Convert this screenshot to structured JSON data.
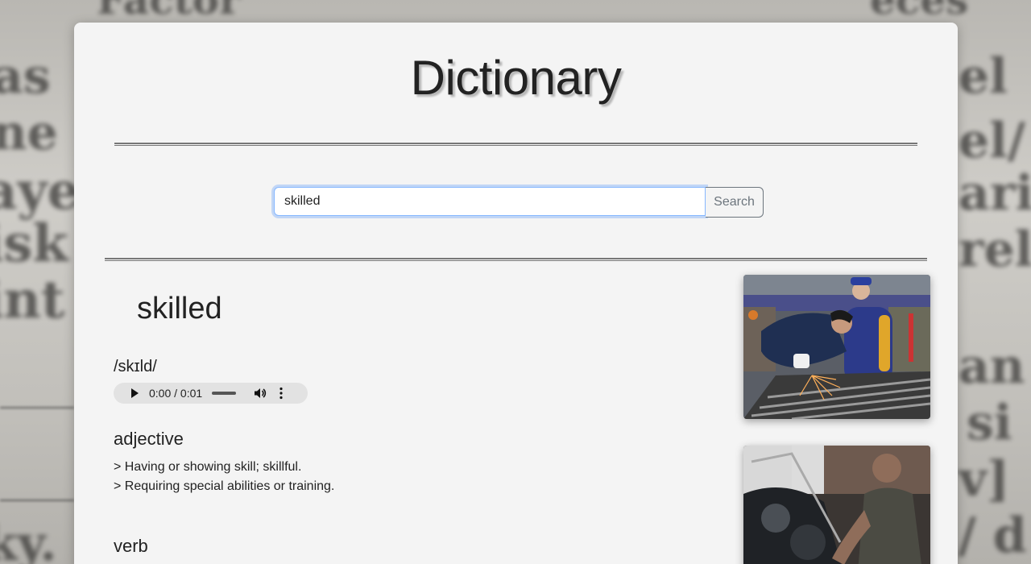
{
  "page": {
    "title": "Dictionary"
  },
  "search": {
    "value": "skilled",
    "placeholder": "",
    "button_label": "Search"
  },
  "entry": {
    "word": "skilled",
    "phonetic": "/skɪld/",
    "audio": {
      "time": "0:00 / 0:01",
      "progress": 0
    },
    "meanings": [
      {
        "part_of_speech": "adjective",
        "definitions": [
          "> Having or showing skill; skillful.",
          "> Requiring special abilities or training."
        ]
      },
      {
        "part_of_speech": "verb",
        "definitions": []
      }
    ]
  },
  "images": [
    {
      "subject": "workers welding metal in a factory"
    },
    {
      "subject": "mechanic working on an engine"
    }
  ],
  "colors": {
    "card_bg": "#f4f4f4",
    "focus_ring": "#86b7fe",
    "button_border": "#6c757d",
    "text": "#222222"
  }
}
